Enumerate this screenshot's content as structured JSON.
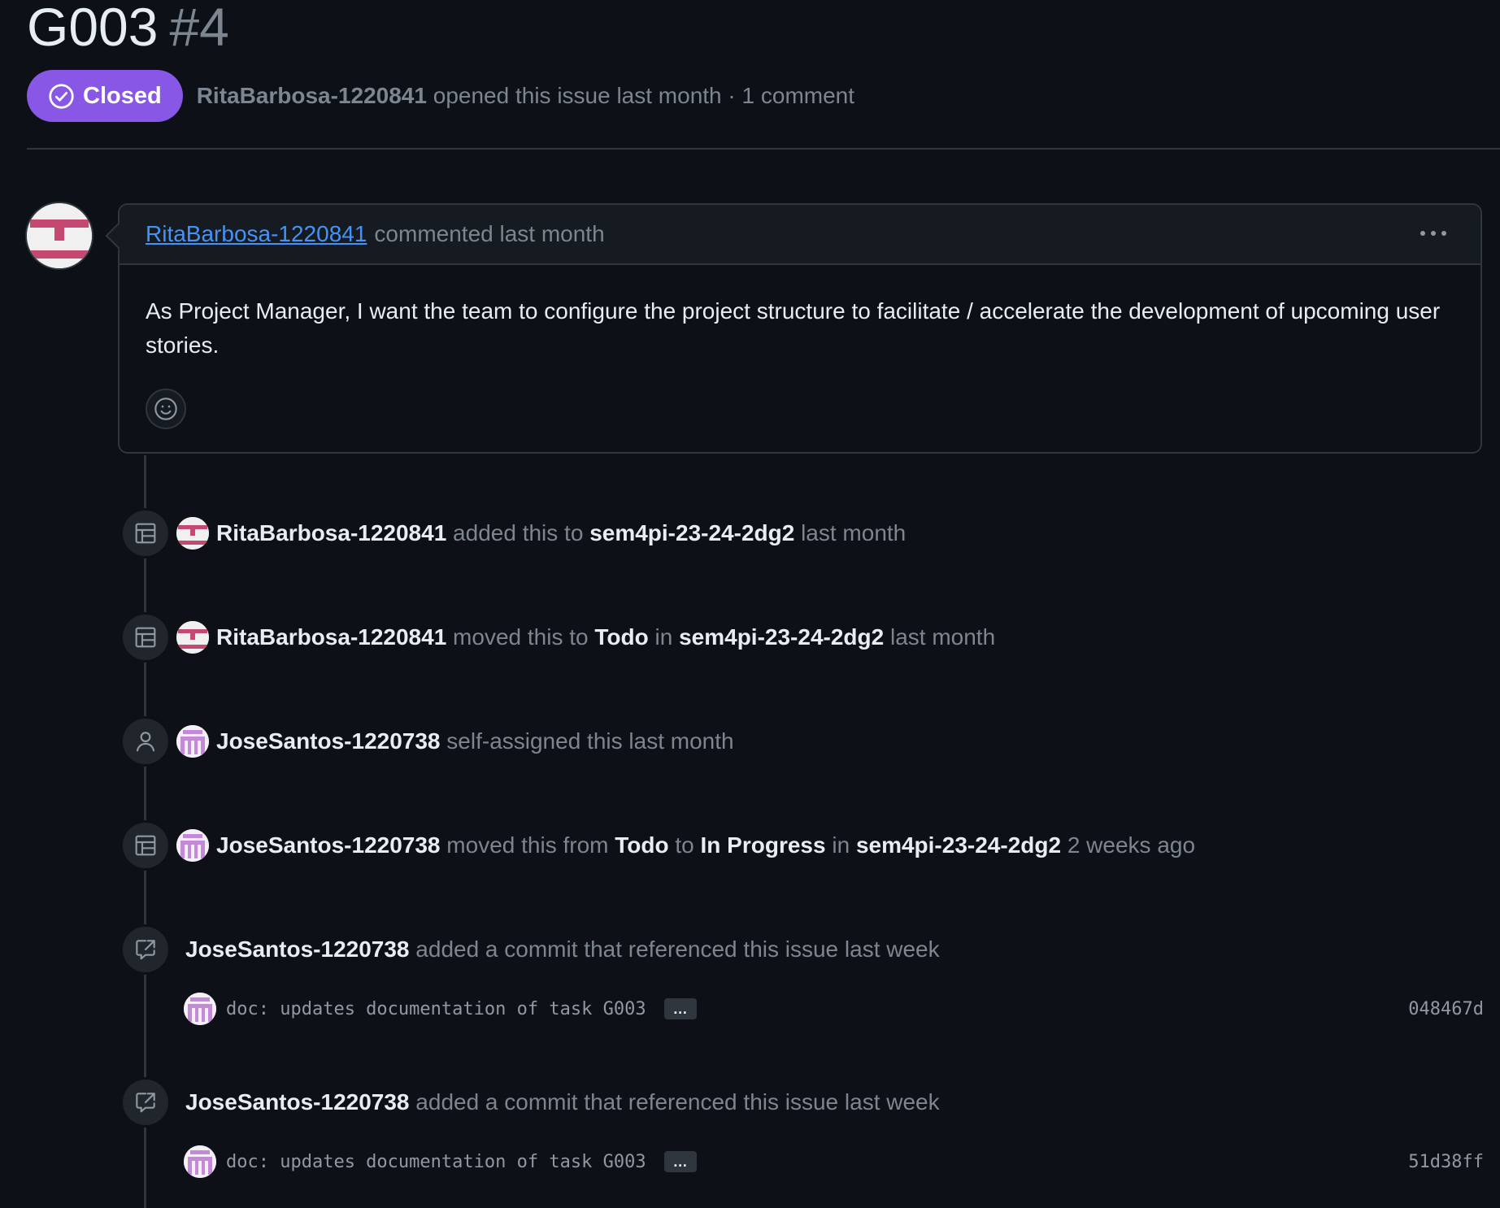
{
  "issue": {
    "title": "G003",
    "number": "#4",
    "state": "Closed",
    "author": "RitaBarbosa-1220841",
    "opened_text": "opened this issue last month · 1 comment"
  },
  "comment": {
    "author": "RitaBarbosa-1220841",
    "header_text": "commented last month",
    "body": "As Project Manager, I want the team to configure the project structure to facilitate / accelerate the development of upcoming user stories."
  },
  "events": [
    {
      "icon": "project-table-icon",
      "avatar": "rita",
      "parts": [
        {
          "t": "RitaBarbosa-1220841",
          "b": true
        },
        {
          "t": " added this to "
        },
        {
          "t": "sem4pi-23-24-2dg2",
          "b": true
        },
        {
          "t": " last month"
        }
      ]
    },
    {
      "icon": "project-table-icon",
      "avatar": "rita",
      "parts": [
        {
          "t": "RitaBarbosa-1220841",
          "b": true
        },
        {
          "t": " moved this to "
        },
        {
          "t": "Todo",
          "b": true
        },
        {
          "t": " in "
        },
        {
          "t": "sem4pi-23-24-2dg2",
          "b": true
        },
        {
          "t": " last month"
        }
      ]
    },
    {
      "icon": "person-icon",
      "avatar": "jose",
      "parts": [
        {
          "t": "JoseSantos-1220738",
          "b": true
        },
        {
          "t": " self-assigned this last month"
        }
      ]
    },
    {
      "icon": "project-table-icon",
      "avatar": "jose",
      "parts": [
        {
          "t": "JoseSantos-1220738",
          "b": true
        },
        {
          "t": " moved this from "
        },
        {
          "t": "Todo",
          "b": true
        },
        {
          "t": " to "
        },
        {
          "t": "In Progress",
          "b": true
        },
        {
          "t": " in "
        },
        {
          "t": "sem4pi-23-24-2dg2",
          "b": true
        },
        {
          "t": " 2 weeks ago"
        }
      ]
    },
    {
      "icon": "cross-reference-icon",
      "avatar": null,
      "parts": [
        {
          "t": "JoseSantos-1220738",
          "b": true
        },
        {
          "t": " added a commit that referenced this issue last week"
        }
      ]
    },
    {
      "icon": "cross-reference-icon",
      "avatar": null,
      "parts": [
        {
          "t": "JoseSantos-1220738",
          "b": true
        },
        {
          "t": " added a commit that referenced this issue last week"
        }
      ]
    }
  ],
  "commits": [
    {
      "message": "doc: updates documentation of task G003",
      "ellipsis": "…",
      "sha": "048467d"
    },
    {
      "message": "doc: updates documentation of task G003",
      "ellipsis": "…",
      "sha": "51d38ff"
    }
  ],
  "colors": {
    "closed_badge": "#8957e5",
    "link": "#4493f8",
    "background": "#0d1117",
    "muted_text": "#7d8590"
  }
}
